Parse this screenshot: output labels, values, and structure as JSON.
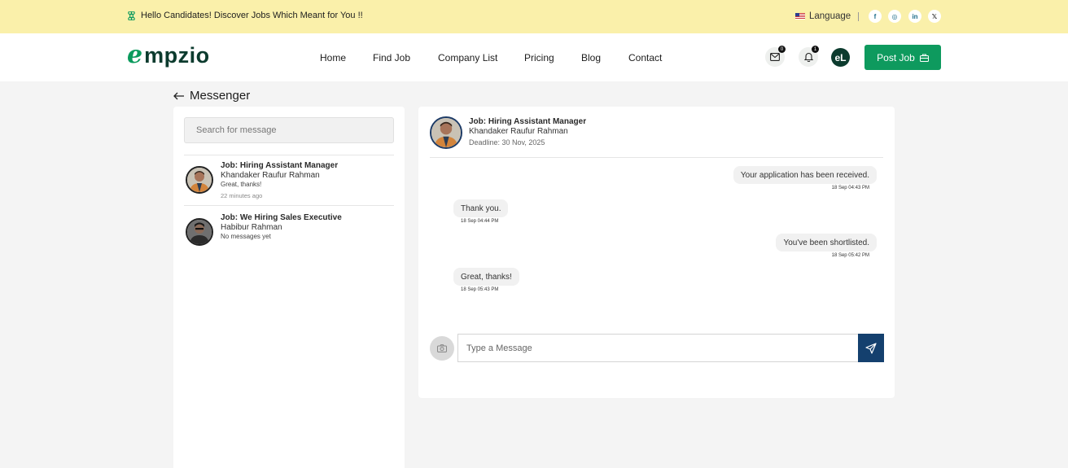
{
  "topbar": {
    "announcement": "Hello Candidates! Discover Jobs Which Meant for You !!",
    "language_label": "Language",
    "social": [
      {
        "icon": "facebook-icon",
        "glyph": "f"
      },
      {
        "icon": "instagram-icon",
        "glyph": "◎"
      },
      {
        "icon": "linkedin-icon",
        "glyph": "in"
      },
      {
        "icon": "x-icon",
        "glyph": "𝕏"
      }
    ]
  },
  "header": {
    "logo_first": "e",
    "logo_rest": "mpzio",
    "nav": [
      "Home",
      "Find Job",
      "Company List",
      "Pricing",
      "Blog",
      "Contact"
    ],
    "message_count": "0",
    "notification_count": "1",
    "avatar_initials": "eL",
    "post_job_label": "Post Job"
  },
  "messenger": {
    "title": "Messenger",
    "search_placeholder": "Search for message",
    "conversations": [
      {
        "job": "Job: Hiring Assistant Manager",
        "name": "Khandaker Raufur Rahman",
        "preview": "Great, thanks!",
        "time": "22 minutes ago"
      },
      {
        "job": "Job: We Hiring Sales Executive",
        "name": "Habibur Rahman",
        "preview": "No messages yet",
        "time": ""
      }
    ]
  },
  "chat": {
    "job": "Job: Hiring Assistant Manager",
    "name": "Khandaker Raufur Rahman",
    "deadline": "Deadline: 30 Nov, 2025",
    "messages": [
      {
        "side": "right",
        "text": "Your application has been received.",
        "time": "18 Sep 04:43 PM"
      },
      {
        "side": "left",
        "text": "Thank you.",
        "time": "18 Sep 04:44 PM"
      },
      {
        "side": "right",
        "text": "You've been shortlisted.",
        "time": "18 Sep 05:42 PM"
      },
      {
        "side": "left",
        "text": "Great, thanks!",
        "time": "18 Sep 05:43 PM"
      }
    ],
    "input_placeholder": "Type a Message"
  },
  "colors": {
    "topbar_bg": "#faf0aa",
    "brand_green": "#0e9a5e",
    "send_blue": "#14406e",
    "page_bg": "#f4f4f4"
  }
}
